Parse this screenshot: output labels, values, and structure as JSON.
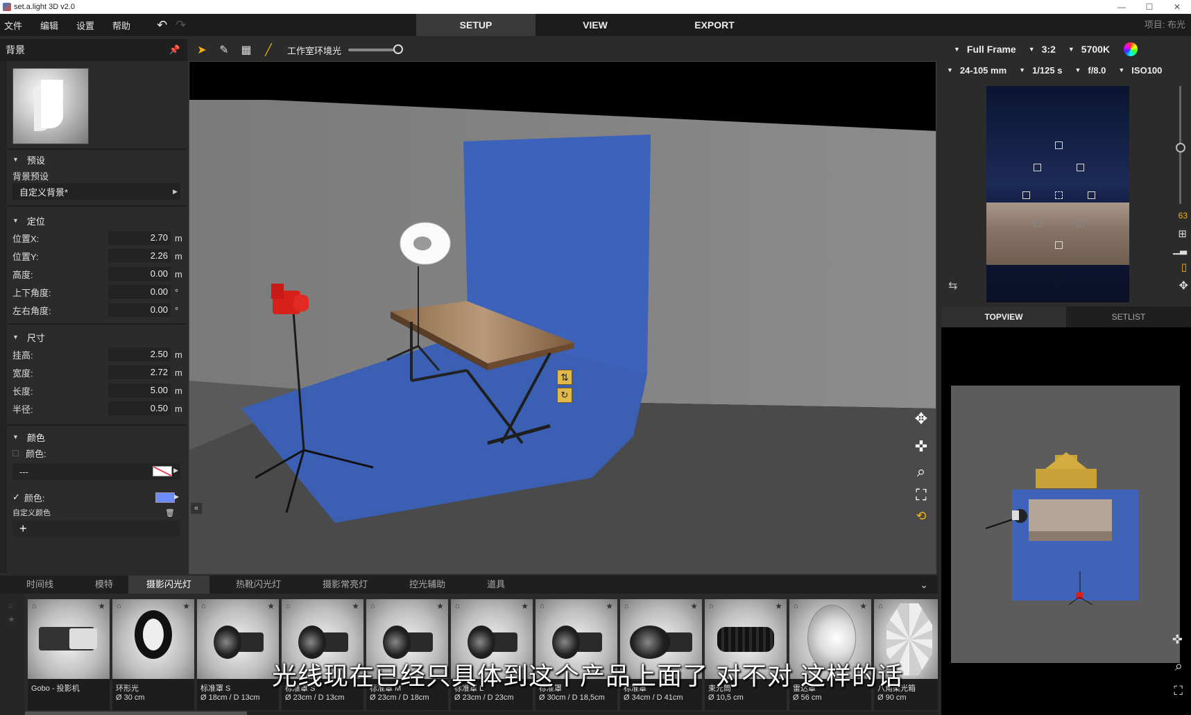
{
  "window": {
    "title": "set.a.light 3D v2.0",
    "controls": [
      "—",
      "☐",
      "✕"
    ]
  },
  "menubar": {
    "menus": [
      "文件",
      "编辑",
      "设置",
      "帮助"
    ],
    "modes": [
      "SETUP",
      "VIEW",
      "EXPORT"
    ],
    "active_mode": "SETUP",
    "project": "项目: 布光"
  },
  "left_panel": {
    "title": "背景",
    "preset": {
      "section": "预设",
      "label": "背景预设",
      "value": "自定义背景*"
    },
    "position": {
      "section": "定位",
      "rows": [
        {
          "label": "位置X:",
          "value": "2.70",
          "unit": "m"
        },
        {
          "label": "位置Y:",
          "value": "2.26",
          "unit": "m"
        },
        {
          "label": "高度:",
          "value": "0.00",
          "unit": "m"
        },
        {
          "label": "上下角度:",
          "value": "0.00",
          "unit": "°"
        },
        {
          "label": "左右角度:",
          "value": "0.00",
          "unit": "°"
        }
      ]
    },
    "size": {
      "section": "尺寸",
      "rows": [
        {
          "label": "挂高:",
          "value": "2.50",
          "unit": "m"
        },
        {
          "label": "宽度:",
          "value": "2.72",
          "unit": "m"
        },
        {
          "label": "长度:",
          "value": "5.00",
          "unit": "m"
        },
        {
          "label": "半径:",
          "value": "0.50",
          "unit": "m"
        }
      ]
    },
    "color": {
      "section": "颜色",
      "color1_label": "颜色:",
      "color1_value": "---",
      "color2_label": "颜色:",
      "color2_hex": "#6b8bff",
      "custom_label": "自定义颜色",
      "add": "+"
    }
  },
  "viewport_toolbar": {
    "ambient_label": "工作室环境光",
    "ambient_level": 1.0
  },
  "camera": {
    "sensor": "Full Frame",
    "ratio": "3:2",
    "wb": "5700K",
    "lens": "24-105 mm",
    "shutter": "1/125 s",
    "aperture": "f/8.0",
    "iso": "ISO100",
    "focal_readout": "63"
  },
  "right_tabs": {
    "tabs": [
      "TOPVIEW",
      "SETLIST"
    ],
    "active": "TOPVIEW"
  },
  "bottom_tabs": {
    "tabs": [
      "时间线",
      "模特",
      "摄影闪光灯",
      "热靴闪光灯",
      "摄影常亮灯",
      "控光辅助",
      "道具"
    ],
    "active": "摄影闪光灯"
  },
  "tray": [
    {
      "name": "Gobo - 投影机",
      "dim": ""
    },
    {
      "name": "环形光",
      "dim": "Ø 30 cm"
    },
    {
      "name": "标准罩 S",
      "dim": "Ø 18cm / D 13cm"
    },
    {
      "name": "标准罩 S",
      "dim": "Ø 23cm / D 13cm"
    },
    {
      "name": "标准罩 M",
      "dim": "Ø 23cm / D 18cm"
    },
    {
      "name": "标准罩 L",
      "dim": "Ø 23cm / D 23cm"
    },
    {
      "name": "标准罩",
      "dim": "Ø 30cm / D 18,5cm"
    },
    {
      "name": "标准罩",
      "dim": "Ø 34cm / D 41cm"
    },
    {
      "name": "束光筒",
      "dim": "Ø 10,5 cm"
    },
    {
      "name": "雷达罩",
      "dim": "Ø 56 cm"
    },
    {
      "name": "八角柔光箱",
      "dim": "Ø 90 cm"
    }
  ],
  "subtitle": "光线现在已经只具体到这个产品上面了 对不对 这样的话",
  "colors": {
    "accent": "#f2b218",
    "backdrop": "#3f63b8",
    "panel": "#2b2b2b"
  }
}
